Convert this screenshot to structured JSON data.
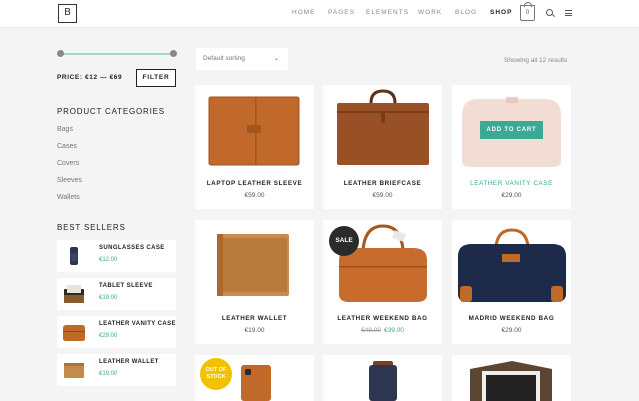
{
  "header": {
    "logo_letter": "B",
    "nav": [
      "HOME",
      "PAGES",
      "ELEMENTS",
      "WORK",
      "BLOG",
      "SHOP"
    ],
    "active_nav": "SHOP",
    "cart_count": "0"
  },
  "sidebar": {
    "price_label": "PRICE: €12 — €69",
    "filter_label": "FILTER",
    "categories_heading": "PRODUCT CATEGORIES",
    "categories": [
      "Bags",
      "Cases",
      "Covers",
      "Sleeves",
      "Wallets"
    ],
    "best_sellers_heading": "BEST SELLERS",
    "best_sellers": [
      {
        "name": "SUNGLASSES CASE",
        "price": "€12.00"
      },
      {
        "name": "TABLET SLEEVE",
        "price": "€19.00"
      },
      {
        "name": "LEATHER VANITY CASE",
        "price": "€29.00"
      },
      {
        "name": "LEATHER WALLET",
        "price": "€19.00"
      }
    ]
  },
  "toolbar": {
    "sort_value": "Default sorting",
    "result_count": "Showing all 12 results"
  },
  "products": [
    {
      "name": "LAPTOP LEATHER SLEEVE",
      "price": "€59.00"
    },
    {
      "name": "LEATHER BRIEFCASE",
      "price": "€59.00"
    },
    {
      "name": "LEATHER VANITY CASE",
      "price": "€29.00",
      "button": "ADD TO CART"
    },
    {
      "name": "LEATHER WALLET",
      "price": "€19.00"
    },
    {
      "name": "LEATHER WEEKEND BAG",
      "old_price": "€49.00",
      "price": "€39.00",
      "badge": "SALE"
    },
    {
      "name": "MADRID WEEKEND BAG",
      "price": "€29.00"
    },
    {
      "badge_line1": "OUT OF",
      "badge_line2": "STOCK"
    }
  ],
  "colors": {
    "accent": "#3aa996",
    "sale_badge": "#2b2b2b",
    "out_of_stock_badge": "#f2c200"
  }
}
